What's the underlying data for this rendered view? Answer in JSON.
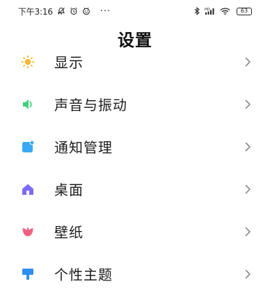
{
  "status_bar": {
    "time": "下午3:16",
    "left_icons": [
      "notification-off-icon",
      "alarm-icon",
      "smiley-icon"
    ],
    "more": "···",
    "right_icons": [
      "bluetooth-icon",
      "signal-icon",
      "wifi-icon"
    ],
    "network_badge": "HD",
    "battery": "63"
  },
  "header": {
    "title": "设置"
  },
  "settings": {
    "items": [
      {
        "label": "显示",
        "icon": "sun-icon",
        "color": "#F7B731"
      },
      {
        "label": "声音与振动",
        "icon": "speaker-icon",
        "color": "#3DD07A"
      },
      {
        "label": "通知管理",
        "icon": "notification-icon",
        "color": "#3AA8F5"
      },
      {
        "label": "桌面",
        "icon": "home-icon",
        "color": "#7B6CF6"
      },
      {
        "label": "壁纸",
        "icon": "tulip-icon",
        "color": "#F0607E"
      },
      {
        "label": "个性主题",
        "icon": "paint-brush-icon",
        "color": "#2F8DF0"
      }
    ]
  },
  "colors": {
    "chevron": "#8a8a8a",
    "text": "#1c1c1c",
    "background": "#ffffff"
  }
}
